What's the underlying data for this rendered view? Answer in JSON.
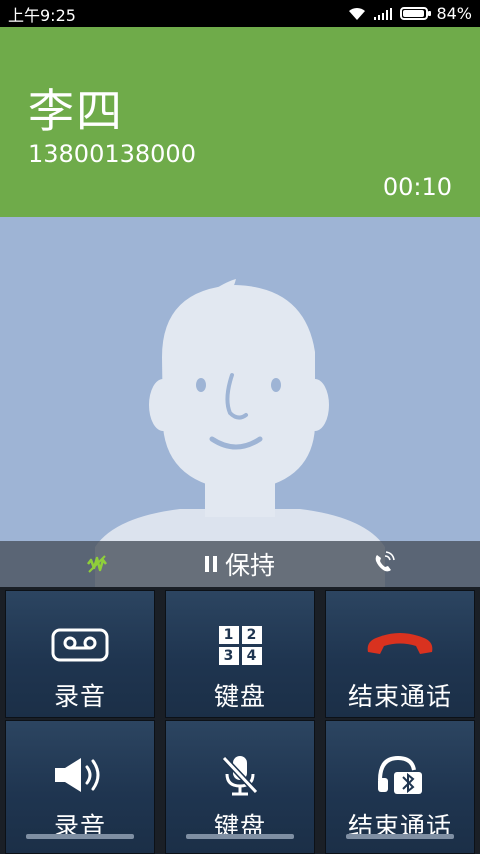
{
  "status_bar": {
    "time": "上午9:25",
    "battery_percent": "84%",
    "battery_level": 0.84
  },
  "caller": {
    "name": "李四",
    "number": "13800138000",
    "timer": "00:10"
  },
  "hold_bar": {
    "hold_label": "保持",
    "left_icon": "noise-reduction-icon",
    "right_icon": "speakerphone-call-icon"
  },
  "controls": {
    "row1": [
      {
        "label": "录音",
        "icon": "record-tape-icon"
      },
      {
        "label": "键盘",
        "icon": "dialpad-icon",
        "keys": [
          "1",
          "2",
          "3",
          "4"
        ]
      },
      {
        "label": "结束通话",
        "icon": "hang-up-icon"
      }
    ],
    "row2": [
      {
        "label": "录音",
        "icon": "speaker-icon"
      },
      {
        "label": "键盘",
        "icon": "mic-mute-icon"
      },
      {
        "label": "结束通话",
        "icon": "bluetooth-headset-icon"
      }
    ]
  },
  "colors": {
    "header_green": "#6fab4a",
    "avatar_bg": "#9eb4d5",
    "hangup_red": "#d9321f"
  }
}
